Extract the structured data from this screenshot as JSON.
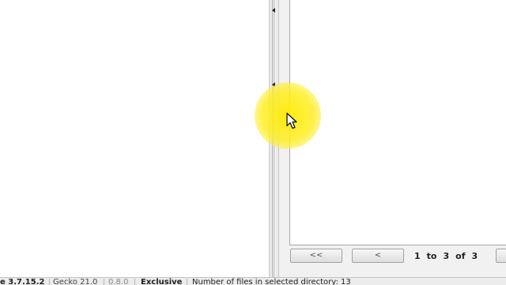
{
  "pager": {
    "first_label": "<<",
    "prev_label": "<",
    "current_page": "1",
    "to_label": "to",
    "last_page": "3",
    "of_label": "of",
    "total_pages": "3"
  },
  "statusbar": {
    "version": "e 3.7.15.2",
    "gecko": "Gecko 21.0",
    "build": "0.8.0",
    "mode": "Exclusive",
    "file_count_text": "Number of files in selected directory: 13"
  },
  "icons": {
    "cursor": "arrow-cursor-icon",
    "highlight": "click-highlight",
    "splitter_arrow": "triangle-left-icon"
  },
  "colors": {
    "highlight": "#ffe600",
    "panel_bg": "#f1f1f1",
    "statusbar_bg": "#ececec"
  }
}
